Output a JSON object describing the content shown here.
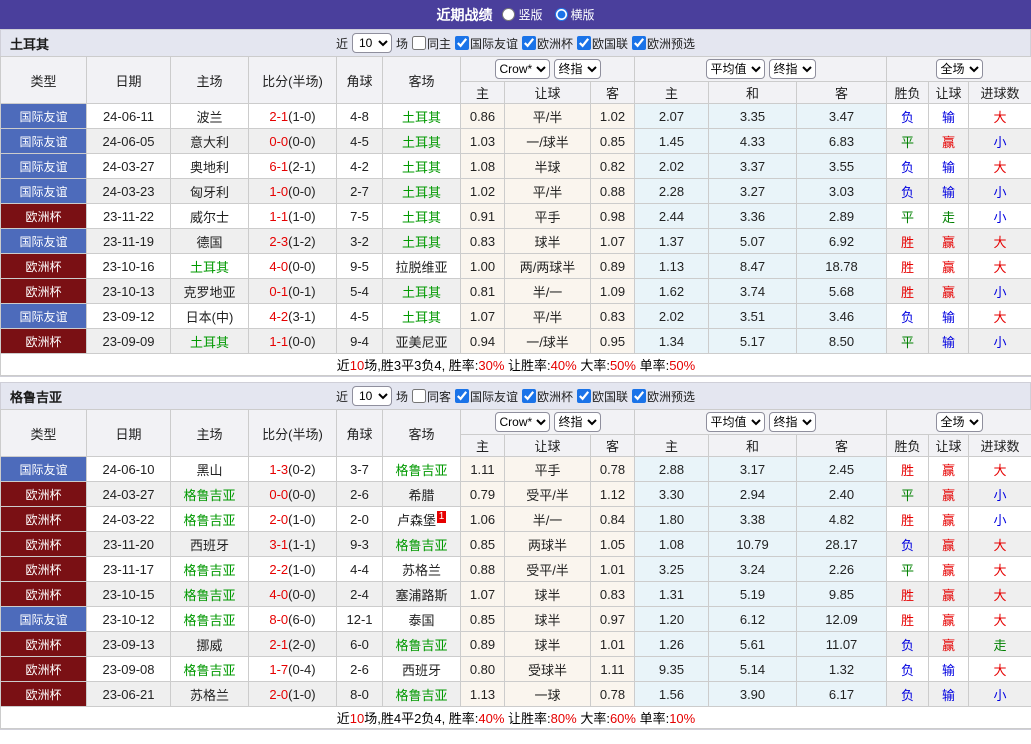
{
  "title_bar": {
    "title": "近期战绩",
    "options": [
      {
        "label": "竖版",
        "selected": false
      },
      {
        "label": "横版",
        "selected": true
      }
    ]
  },
  "headers": {
    "type": "类型",
    "date": "日期",
    "home": "主场",
    "score": "比分(半场)",
    "corner": "角球",
    "away": "客场",
    "crow_select": "Crow*",
    "final_select_1": "终指",
    "avg_select": "平均值",
    "final_select_2": "终指",
    "fulltime_select": "全场",
    "ah_home": "主",
    "ah_line": "让球",
    "ah_away": "客",
    "eu_home": "主",
    "eu_draw": "和",
    "eu_away": "客",
    "wdl": "胜负",
    "ah_result": "让球",
    "goals": "进球数"
  },
  "colors": {
    "title_bar_bg": "#4a3f9c",
    "accent_blue": "#1a73e8",
    "badge_friendly": "#4d6bbb",
    "badge_cup": "#7a1014",
    "team_highlight": "#009900",
    "win_red": "#e60000",
    "draw_green": "#008000",
    "lose_blue": "#0000e0",
    "ah_col_bg": "#faf5ee",
    "eu_col_bg": "#e9f4f9"
  },
  "sections": [
    {
      "team": "土耳其",
      "filter": {
        "near": "近",
        "matches": "10",
        "games": "场",
        "same": "同主",
        "leagues": [
          {
            "label": "国际友谊",
            "checked": true
          },
          {
            "label": "欧洲杯",
            "checked": true
          },
          {
            "label": "欧国联",
            "checked": true
          },
          {
            "label": "欧洲预选",
            "checked": true
          }
        ]
      },
      "rows": [
        {
          "type": "国际友谊",
          "tc": "blue",
          "date": "24-06-11",
          "home": "波兰",
          "hg": false,
          "score": "2-1",
          "half": "(1-0)",
          "corner": "4-8",
          "away": "土耳其",
          "ag": true,
          "ab": "",
          "ah": [
            "0.86",
            "平/半",
            "1.02"
          ],
          "eu": [
            "2.07",
            "3.35",
            "3.47"
          ],
          "res": [
            [
              "负",
              "b"
            ],
            [
              "输",
              "b"
            ],
            [
              "大",
              "r"
            ]
          ]
        },
        {
          "type": "国际友谊",
          "tc": "blue",
          "date": "24-06-05",
          "home": "意大利",
          "hg": false,
          "score": "0-0",
          "half": "(0-0)",
          "corner": "4-5",
          "away": "土耳其",
          "ag": true,
          "ab": "",
          "ah": [
            "1.03",
            "一/球半",
            "0.85"
          ],
          "eu": [
            "1.45",
            "4.33",
            "6.83"
          ],
          "res": [
            [
              "平",
              "g"
            ],
            [
              "赢",
              "r"
            ],
            [
              "小",
              "b"
            ]
          ]
        },
        {
          "type": "国际友谊",
          "tc": "blue",
          "date": "24-03-27",
          "home": "奥地利",
          "hg": false,
          "score": "6-1",
          "half": "(2-1)",
          "corner": "4-2",
          "away": "土耳其",
          "ag": true,
          "ab": "",
          "ah": [
            "1.08",
            "半球",
            "0.82"
          ],
          "eu": [
            "2.02",
            "3.37",
            "3.55"
          ],
          "res": [
            [
              "负",
              "b"
            ],
            [
              "输",
              "b"
            ],
            [
              "大",
              "r"
            ]
          ]
        },
        {
          "type": "国际友谊",
          "tc": "blue",
          "date": "24-03-23",
          "home": "匈牙利",
          "hg": false,
          "score": "1-0",
          "half": "(0-0)",
          "corner": "2-7",
          "away": "土耳其",
          "ag": true,
          "ab": "",
          "ah": [
            "1.02",
            "平/半",
            "0.88"
          ],
          "eu": [
            "2.28",
            "3.27",
            "3.03"
          ],
          "res": [
            [
              "负",
              "b"
            ],
            [
              "输",
              "b"
            ],
            [
              "小",
              "b"
            ]
          ]
        },
        {
          "type": "欧洲杯",
          "tc": "maroon",
          "date": "23-11-22",
          "home": "威尔士",
          "hg": false,
          "score": "1-1",
          "half": "(1-0)",
          "corner": "7-5",
          "away": "土耳其",
          "ag": true,
          "ab": "",
          "ah": [
            "0.91",
            "平手",
            "0.98"
          ],
          "eu": [
            "2.44",
            "3.36",
            "2.89"
          ],
          "res": [
            [
              "平",
              "g"
            ],
            [
              "走",
              "g"
            ],
            [
              "小",
              "b"
            ]
          ]
        },
        {
          "type": "国际友谊",
          "tc": "blue",
          "date": "23-11-19",
          "home": "德国",
          "hg": false,
          "score": "2-3",
          "half": "(1-2)",
          "corner": "3-2",
          "away": "土耳其",
          "ag": true,
          "ab": "",
          "ah": [
            "0.83",
            "球半",
            "1.07"
          ],
          "eu": [
            "1.37",
            "5.07",
            "6.92"
          ],
          "res": [
            [
              "胜",
              "r"
            ],
            [
              "赢",
              "r"
            ],
            [
              "大",
              "r"
            ]
          ]
        },
        {
          "type": "欧洲杯",
          "tc": "maroon",
          "date": "23-10-16",
          "home": "土耳其",
          "hg": true,
          "score": "4-0",
          "half": "(0-0)",
          "corner": "9-5",
          "away": "拉脱维亚",
          "ag": false,
          "ab": "",
          "ah": [
            "1.00",
            "两/两球半",
            "0.89"
          ],
          "eu": [
            "1.13",
            "8.47",
            "18.78"
          ],
          "res": [
            [
              "胜",
              "r"
            ],
            [
              "赢",
              "r"
            ],
            [
              "大",
              "r"
            ]
          ]
        },
        {
          "type": "欧洲杯",
          "tc": "maroon",
          "date": "23-10-13",
          "home": "克罗地亚",
          "hg": false,
          "score": "0-1",
          "half": "(0-1)",
          "corner": "5-4",
          "away": "土耳其",
          "ag": true,
          "ab": "",
          "ah": [
            "0.81",
            "半/一",
            "1.09"
          ],
          "eu": [
            "1.62",
            "3.74",
            "5.68"
          ],
          "res": [
            [
              "胜",
              "r"
            ],
            [
              "赢",
              "r"
            ],
            [
              "小",
              "b"
            ]
          ]
        },
        {
          "type": "国际友谊",
          "tc": "blue",
          "date": "23-09-12",
          "home": "日本(中)",
          "hg": false,
          "score": "4-2",
          "half": "(3-1)",
          "corner": "4-5",
          "away": "土耳其",
          "ag": true,
          "ab": "",
          "ah": [
            "1.07",
            "平/半",
            "0.83"
          ],
          "eu": [
            "2.02",
            "3.51",
            "3.46"
          ],
          "res": [
            [
              "负",
              "b"
            ],
            [
              "输",
              "b"
            ],
            [
              "大",
              "r"
            ]
          ]
        },
        {
          "type": "欧洲杯",
          "tc": "maroon",
          "date": "23-09-09",
          "home": "土耳其",
          "hg": true,
          "score": "1-1",
          "half": "(0-0)",
          "corner": "9-4",
          "away": "亚美尼亚",
          "ag": false,
          "ab": "",
          "ah": [
            "0.94",
            "一/球半",
            "0.95"
          ],
          "eu": [
            "1.34",
            "5.17",
            "8.50"
          ],
          "res": [
            [
              "平",
              "g"
            ],
            [
              "输",
              "b"
            ],
            [
              "小",
              "b"
            ]
          ]
        }
      ],
      "summary": [
        [
          "近",
          "k"
        ],
        [
          "10",
          "r"
        ],
        [
          "场,胜3平3负4, 胜率:",
          "k"
        ],
        [
          "30%",
          "r"
        ],
        [
          " 让胜率:",
          "k"
        ],
        [
          "40%",
          "r"
        ],
        [
          " 大率:",
          "k"
        ],
        [
          "50%",
          "r"
        ],
        [
          " 单率:",
          "k"
        ],
        [
          "50%",
          "r"
        ]
      ]
    },
    {
      "team": "格鲁吉亚",
      "filter": {
        "near": "近",
        "matches": "10",
        "games": "场",
        "same": "同客",
        "leagues": [
          {
            "label": "国际友谊",
            "checked": true
          },
          {
            "label": "欧洲杯",
            "checked": true
          },
          {
            "label": "欧国联",
            "checked": true
          },
          {
            "label": "欧洲预选",
            "checked": true
          }
        ]
      },
      "rows": [
        {
          "type": "国际友谊",
          "tc": "blue",
          "date": "24-06-10",
          "home": "黑山",
          "hg": false,
          "score": "1-3",
          "half": "(0-2)",
          "corner": "3-7",
          "away": "格鲁吉亚",
          "ag": true,
          "ab": "",
          "ah": [
            "1.11",
            "平手",
            "0.78"
          ],
          "eu": [
            "2.88",
            "3.17",
            "2.45"
          ],
          "res": [
            [
              "胜",
              "r"
            ],
            [
              "赢",
              "r"
            ],
            [
              "大",
              "r"
            ]
          ]
        },
        {
          "type": "欧洲杯",
          "tc": "maroon",
          "date": "24-03-27",
          "home": "格鲁吉亚",
          "hg": true,
          "score": "0-0",
          "half": "(0-0)",
          "corner": "2-6",
          "away": "希腊",
          "ag": false,
          "ab": "",
          "ah": [
            "0.79",
            "受平/半",
            "1.12"
          ],
          "eu": [
            "3.30",
            "2.94",
            "2.40"
          ],
          "res": [
            [
              "平",
              "g"
            ],
            [
              "赢",
              "r"
            ],
            [
              "小",
              "b"
            ]
          ]
        },
        {
          "type": "欧洲杯",
          "tc": "maroon",
          "date": "24-03-22",
          "home": "格鲁吉亚",
          "hg": true,
          "score": "2-0",
          "half": "(1-0)",
          "corner": "2-0",
          "away": "卢森堡",
          "ag": false,
          "ab": "1",
          "ah": [
            "1.06",
            "半/一",
            "0.84"
          ],
          "eu": [
            "1.80",
            "3.38",
            "4.82"
          ],
          "res": [
            [
              "胜",
              "r"
            ],
            [
              "赢",
              "r"
            ],
            [
              "小",
              "b"
            ]
          ]
        },
        {
          "type": "欧洲杯",
          "tc": "maroon",
          "date": "23-11-20",
          "home": "西班牙",
          "hg": false,
          "score": "3-1",
          "half": "(1-1)",
          "corner": "9-3",
          "away": "格鲁吉亚",
          "ag": true,
          "ab": "",
          "ah": [
            "0.85",
            "两球半",
            "1.05"
          ],
          "eu": [
            "1.08",
            "10.79",
            "28.17"
          ],
          "res": [
            [
              "负",
              "b"
            ],
            [
              "赢",
              "r"
            ],
            [
              "大",
              "r"
            ]
          ]
        },
        {
          "type": "欧洲杯",
          "tc": "maroon",
          "date": "23-11-17",
          "home": "格鲁吉亚",
          "hg": true,
          "score": "2-2",
          "half": "(1-0)",
          "corner": "4-4",
          "away": "苏格兰",
          "ag": false,
          "ab": "",
          "ah": [
            "0.88",
            "受平/半",
            "1.01"
          ],
          "eu": [
            "3.25",
            "3.24",
            "2.26"
          ],
          "res": [
            [
              "平",
              "g"
            ],
            [
              "赢",
              "r"
            ],
            [
              "大",
              "r"
            ]
          ]
        },
        {
          "type": "欧洲杯",
          "tc": "maroon",
          "date": "23-10-15",
          "home": "格鲁吉亚",
          "hg": true,
          "score": "4-0",
          "half": "(0-0)",
          "corner": "2-4",
          "away": "塞浦路斯",
          "ag": false,
          "ab": "",
          "ah": [
            "1.07",
            "球半",
            "0.83"
          ],
          "eu": [
            "1.31",
            "5.19",
            "9.85"
          ],
          "res": [
            [
              "胜",
              "r"
            ],
            [
              "赢",
              "r"
            ],
            [
              "大",
              "r"
            ]
          ]
        },
        {
          "type": "国际友谊",
          "tc": "blue",
          "date": "23-10-12",
          "home": "格鲁吉亚",
          "hg": true,
          "score": "8-0",
          "half": "(6-0)",
          "corner": "12-1",
          "away": "泰国",
          "ag": false,
          "ab": "",
          "ah": [
            "0.85",
            "球半",
            "0.97"
          ],
          "eu": [
            "1.20",
            "6.12",
            "12.09"
          ],
          "res": [
            [
              "胜",
              "r"
            ],
            [
              "赢",
              "r"
            ],
            [
              "大",
              "r"
            ]
          ]
        },
        {
          "type": "欧洲杯",
          "tc": "maroon",
          "date": "23-09-13",
          "home": "挪威",
          "hg": false,
          "score": "2-1",
          "half": "(2-0)",
          "corner": "6-0",
          "away": "格鲁吉亚",
          "ag": true,
          "ab": "",
          "ah": [
            "0.89",
            "球半",
            "1.01"
          ],
          "eu": [
            "1.26",
            "5.61",
            "11.07"
          ],
          "res": [
            [
              "负",
              "b"
            ],
            [
              "赢",
              "r"
            ],
            [
              "走",
              "g"
            ]
          ]
        },
        {
          "type": "欧洲杯",
          "tc": "maroon",
          "date": "23-09-08",
          "home": "格鲁吉亚",
          "hg": true,
          "score": "1-7",
          "half": "(0-4)",
          "corner": "2-6",
          "away": "西班牙",
          "ag": false,
          "ab": "",
          "ah": [
            "0.80",
            "受球半",
            "1.11"
          ],
          "eu": [
            "9.35",
            "5.14",
            "1.32"
          ],
          "res": [
            [
              "负",
              "b"
            ],
            [
              "输",
              "b"
            ],
            [
              "大",
              "r"
            ]
          ]
        },
        {
          "type": "欧洲杯",
          "tc": "maroon",
          "date": "23-06-21",
          "home": "苏格兰",
          "hg": false,
          "score": "2-0",
          "half": "(1-0)",
          "corner": "8-0",
          "away": "格鲁吉亚",
          "ag": true,
          "ab": "",
          "ah": [
            "1.13",
            "一球",
            "0.78"
          ],
          "eu": [
            "1.56",
            "3.90",
            "6.17"
          ],
          "res": [
            [
              "负",
              "b"
            ],
            [
              "输",
              "b"
            ],
            [
              "小",
              "b"
            ]
          ]
        }
      ],
      "summary": [
        [
          "近",
          "k"
        ],
        [
          "10",
          "r"
        ],
        [
          "场,胜4平2负4, 胜率:",
          "k"
        ],
        [
          "40%",
          "r"
        ],
        [
          " 让胜率:",
          "k"
        ],
        [
          "80%",
          "r"
        ],
        [
          " 大率:",
          "k"
        ],
        [
          "60%",
          "r"
        ],
        [
          " 单率:",
          "k"
        ],
        [
          "10%",
          "r"
        ]
      ]
    }
  ]
}
